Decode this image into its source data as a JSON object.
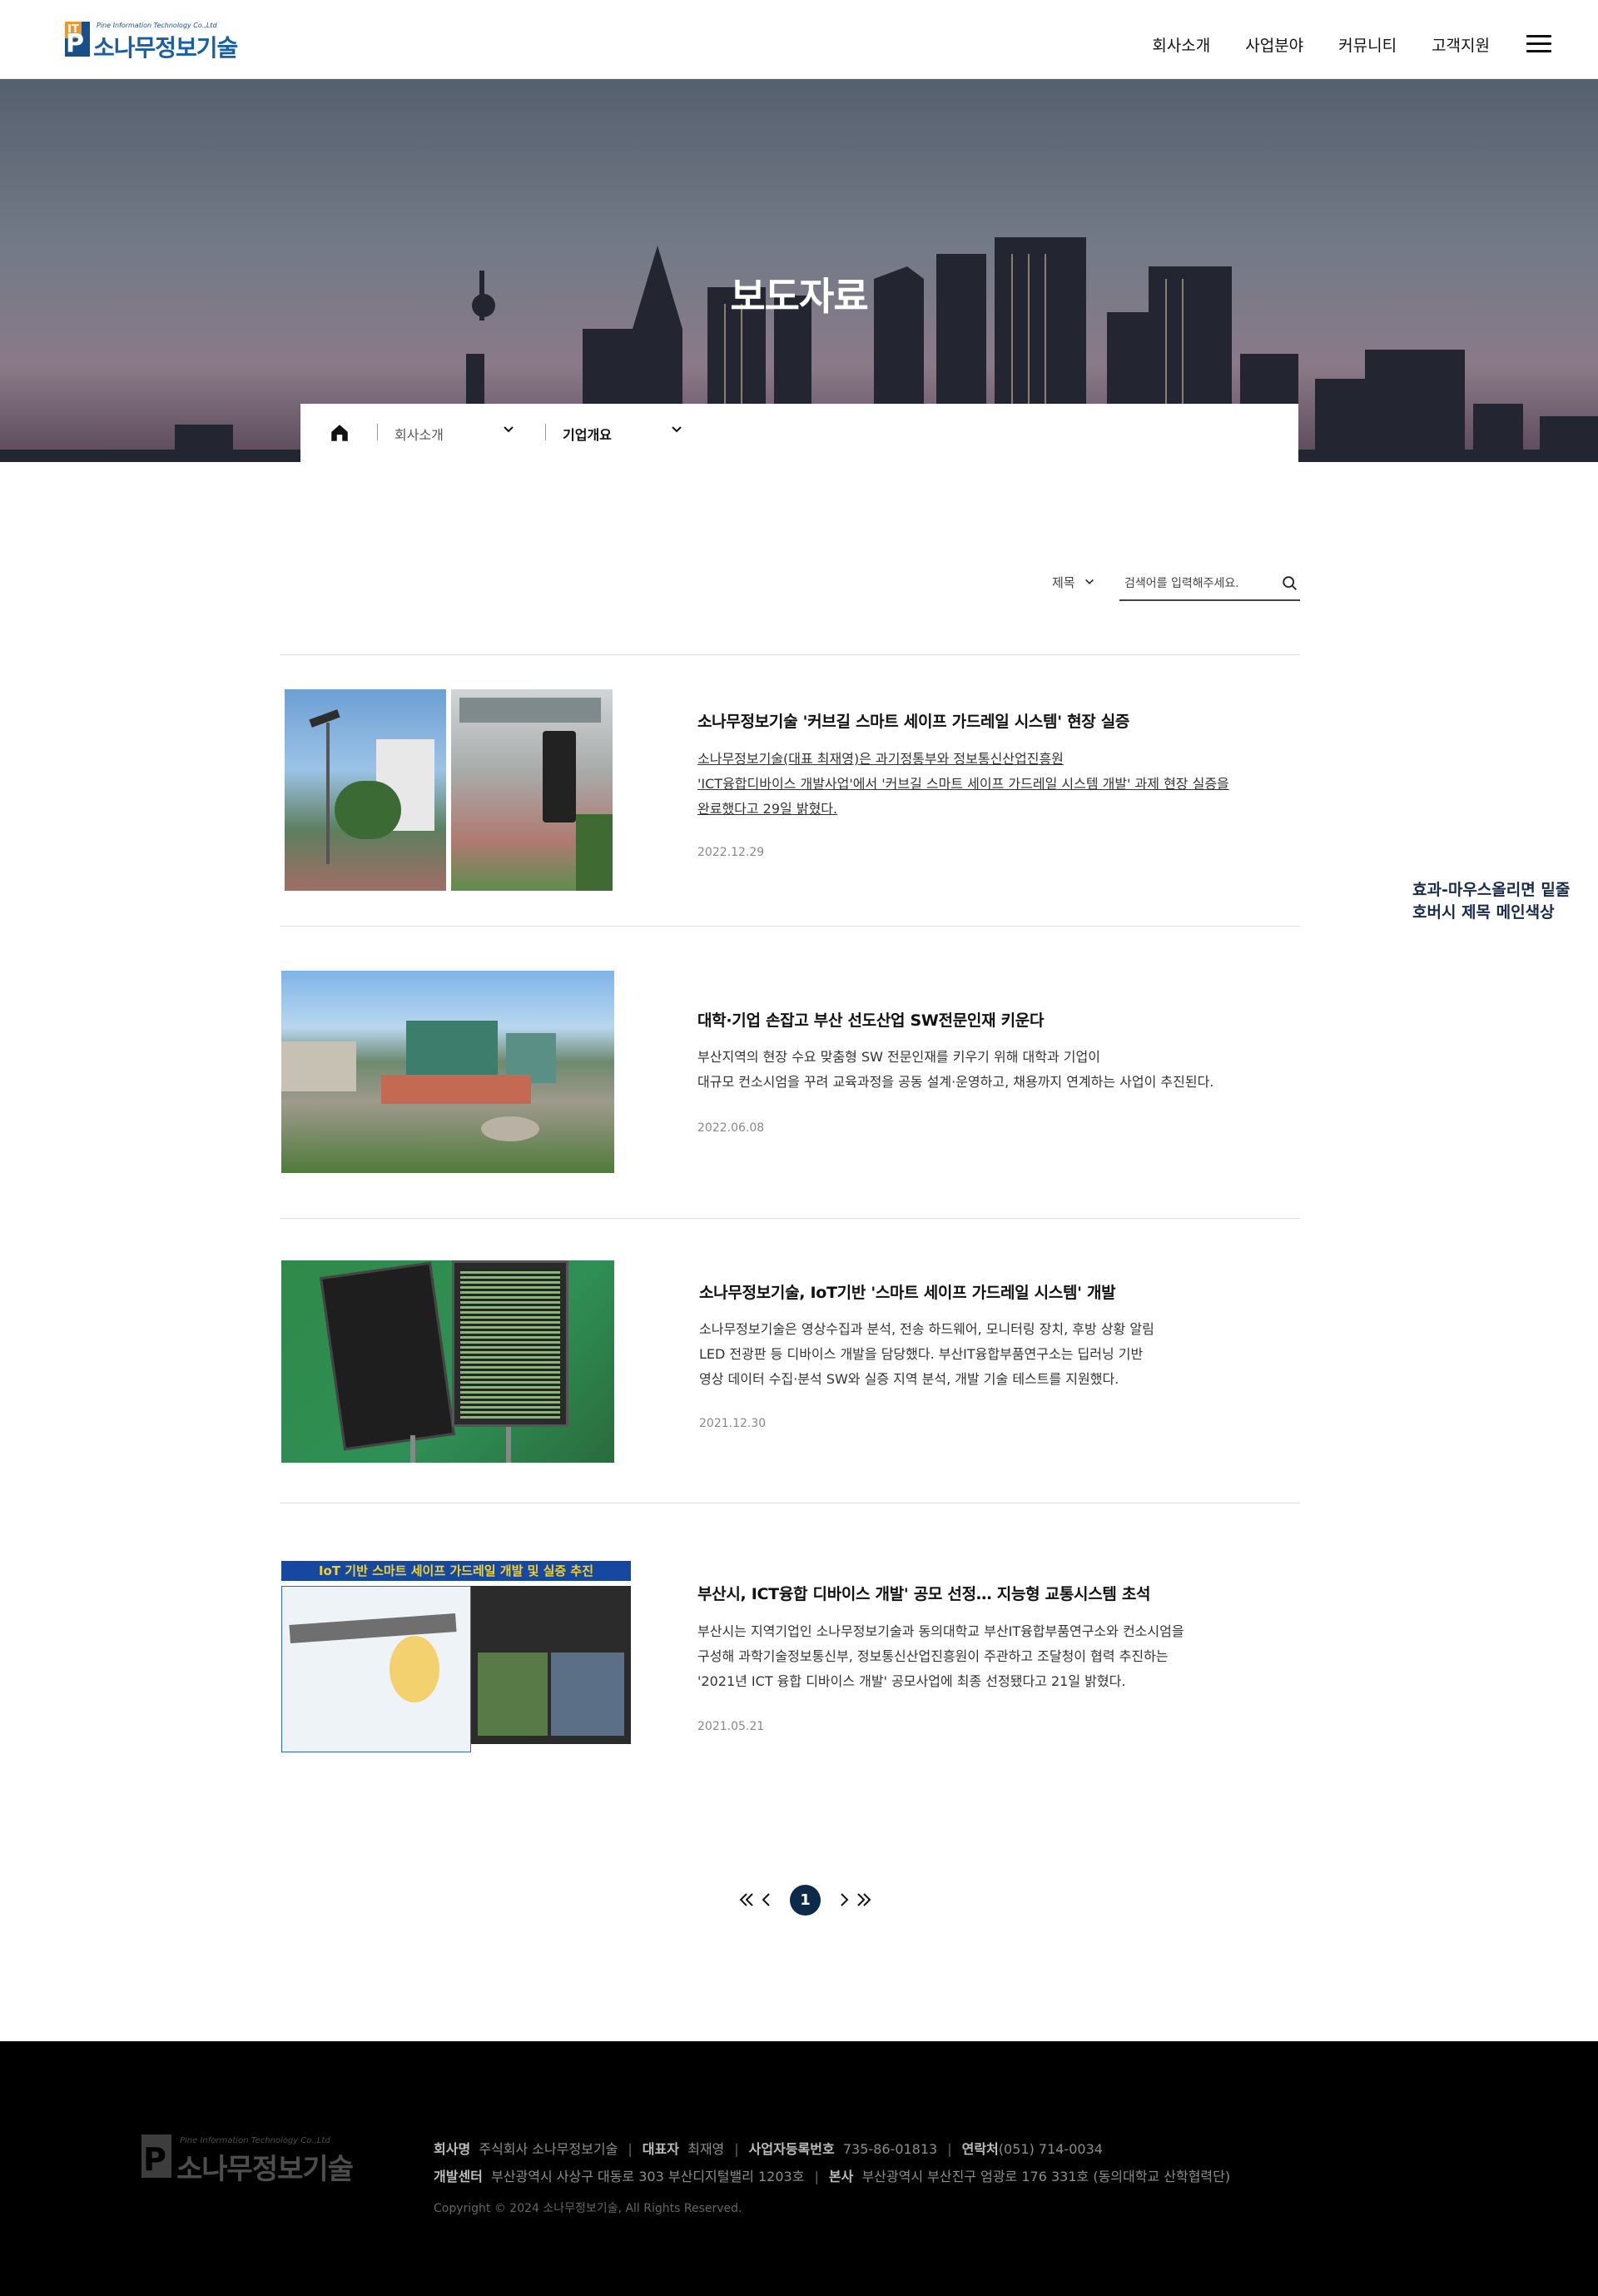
{
  "header": {
    "logo_en": "Pine Information Technology Co.,Ltd",
    "logo_ko": "소나무정보기술",
    "logo_badge": "IT",
    "nav": [
      "회사소개",
      "사업분야",
      "커뮤니티",
      "고객지원"
    ]
  },
  "hero": {
    "title": "보도자료"
  },
  "breadcrumb": {
    "level1": "회사소개",
    "level2": "기업개요"
  },
  "search": {
    "select_value": "제목",
    "placeholder": "검색어를 입력해주세요."
  },
  "posts": [
    {
      "title": "소나무정보기술 '커브길 스마트 세이프 가드레일 시스템' 현장 실증",
      "desc": [
        "소나무정보기술(대표 최재영)은 과기정통부와 정보통신산업진흥원",
        "'ICT융합디바이스 개발사업'에서 '커브길 스마트 세이프 가드레일 시스템 개발' 과제 현장 실증을",
        "완료했다고 29일 밝혔다."
      ],
      "date": "2022.12.29"
    },
    {
      "title": "대학·기업 손잡고 부산 선도산업 SW전문인재 키운다",
      "desc": [
        "부산지역의 현장 수요 맞춤형 SW 전문인재를 키우기 위해 대학과 기업이",
        "대규모 컨소시엄을 꾸려 교육과정을 공동 설계·운영하고, 채용까지 연계하는 사업이 추진된다."
      ],
      "date": "2022.06.08"
    },
    {
      "title": "소나무정보기술, IoT기반 '스마트 세이프 가드레일 시스템' 개발",
      "desc": [
        "소나무정보기술은 영상수집과 분석, 전송 하드웨어, 모니터링 장치, 후방 상황 알림",
        "LED 전광판 등 디바이스 개발을 담당했다. 부산IT융합부품연구소는 딥러닝 기반",
        "영상 데이터 수집·분석 SW와 실증 지역 분석, 개발 기술 테스트를 지원했다."
      ],
      "date": "2021.12.30"
    },
    {
      "title": "부산시, ICT융합 디바이스 개발' 공모 선정… 지능형 교통시스템 초석",
      "desc": [
        "부산시는 지역기업인 소나무정보기술과 동의대학교 부산IT융합부품연구소와 컨소시엄을",
        "구성해 과학기술정보통신부, 정보통신산업진흥원이 주관하고 조달청이 협력 추진하는",
        "'2021년 ICT 융합 디바이스 개발' 공모사업에 최종 선정됐다고 21일 밝혔다."
      ],
      "date": "2021.05.21",
      "image_caption": "IoT 기반 스마트 세이프 가드레일 개발 및 실증 추진"
    }
  ],
  "side_note": [
    "효과-마우스올리면 밑줄",
    "호버시 제목 메인색상"
  ],
  "pagination": {
    "current": "1"
  },
  "footer": {
    "company_label": "회사명",
    "company": "주식회사 소나무정보기술",
    "ceo_label": "대표자",
    "ceo": "최재영",
    "biz_label": "사업자등록번호",
    "biz": "735-86-01813",
    "tel_label": "연락처",
    "tel": "(051) 714-0034",
    "dev_label": "개발센터",
    "dev": "부산광역시 사상구 대동로 303 부산디지털밸리 1203호",
    "hq_label": "본사",
    "hq": "부산광역시 부산진구 엄광로 176 331호 (동의대학교 산학협력단)",
    "copyright": "Copyright © 2024 소나무정보기술, All Rights Reserved."
  },
  "colors": {
    "brand_navy": "#0d2a4a",
    "brand_blue": "#1a5fa3",
    "footer_bg": "#000000"
  }
}
